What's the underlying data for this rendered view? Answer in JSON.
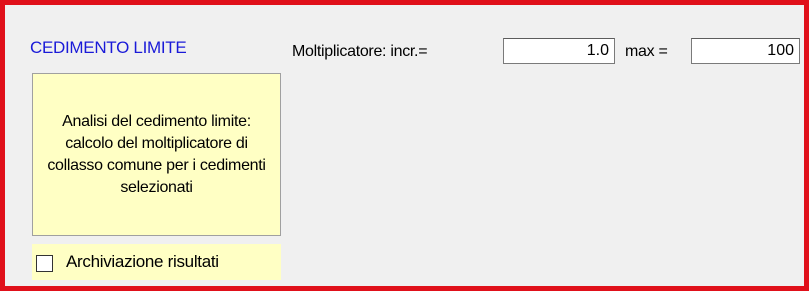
{
  "panel": {
    "title": "CEDIMENTO LIMITE"
  },
  "multiplier": {
    "label": "Moltiplicatore: incr.=",
    "incr_value": "1.0",
    "max_label": "max =",
    "max_value": "100"
  },
  "analysis_button": {
    "label": "Analisi del cedimento limite: calcolo del moltiplicatore di collasso comune per i cedimenti selezionati"
  },
  "archive": {
    "label": "Archiviazione risultati",
    "checked": false
  },
  "colors": {
    "border": "#e0101a",
    "title": "#1a1ad8",
    "button_background": "#ffffc4",
    "panel_background": "#f0f0f0"
  }
}
